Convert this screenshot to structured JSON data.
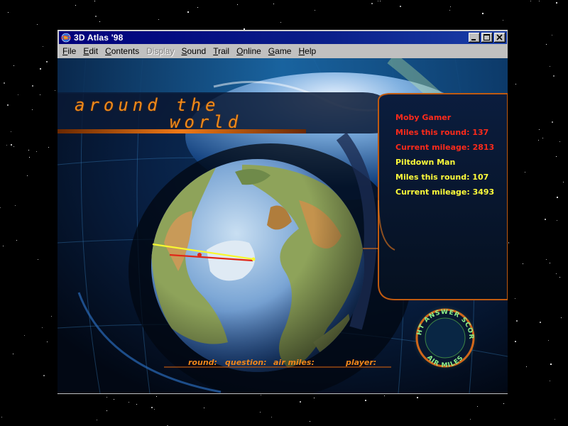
{
  "window": {
    "title": "3D Atlas '98"
  },
  "menu": [
    {
      "label": "File",
      "ul": "F",
      "rest": "ile",
      "enabled": true
    },
    {
      "label": "Edit",
      "ul": "E",
      "rest": "dit",
      "enabled": true
    },
    {
      "label": "Contents",
      "ul": "C",
      "rest": "ontents",
      "enabled": true
    },
    {
      "label": "Display",
      "ul": "",
      "rest": "Display",
      "enabled": false
    },
    {
      "label": "Sound",
      "ul": "S",
      "rest": "ound",
      "enabled": true
    },
    {
      "label": "Trail",
      "ul": "T",
      "rest": "rail",
      "enabled": true
    },
    {
      "label": "Online",
      "ul": "O",
      "rest": "nline",
      "enabled": true
    },
    {
      "label": "Game",
      "ul": "G",
      "rest": "ame",
      "enabled": true
    },
    {
      "label": "Help",
      "ul": "H",
      "rest": "elp",
      "enabled": true
    }
  ],
  "game": {
    "title_line1": "around the",
    "title_line2": "world",
    "players": [
      {
        "name": "Moby Gamer",
        "miles_round": "Miles this round: 137",
        "current_mileage": "Current mileage: 2813",
        "color": "#ff2a1a"
      },
      {
        "name": "Piltdown Man",
        "miles_round": "Miles this round: 107",
        "current_mileage": "Current mileage: 3493",
        "color": "#fffc3a"
      }
    ],
    "bottom_labels": {
      "round": "round:",
      "question": "question:",
      "air_miles": "air miles:",
      "player": "player:"
    },
    "mode_button": {
      "top_text": "RIGHT ANSWER SCORES",
      "bottom_text": "AIR MILES"
    }
  },
  "colors": {
    "title_orange": "#f08a1a",
    "label_orange": "#f0861a",
    "player1_red": "#ff2a1a",
    "player2_yellow": "#fffc3a",
    "button_green": "#8cf08a",
    "titlebar_blue": "#00007b"
  }
}
